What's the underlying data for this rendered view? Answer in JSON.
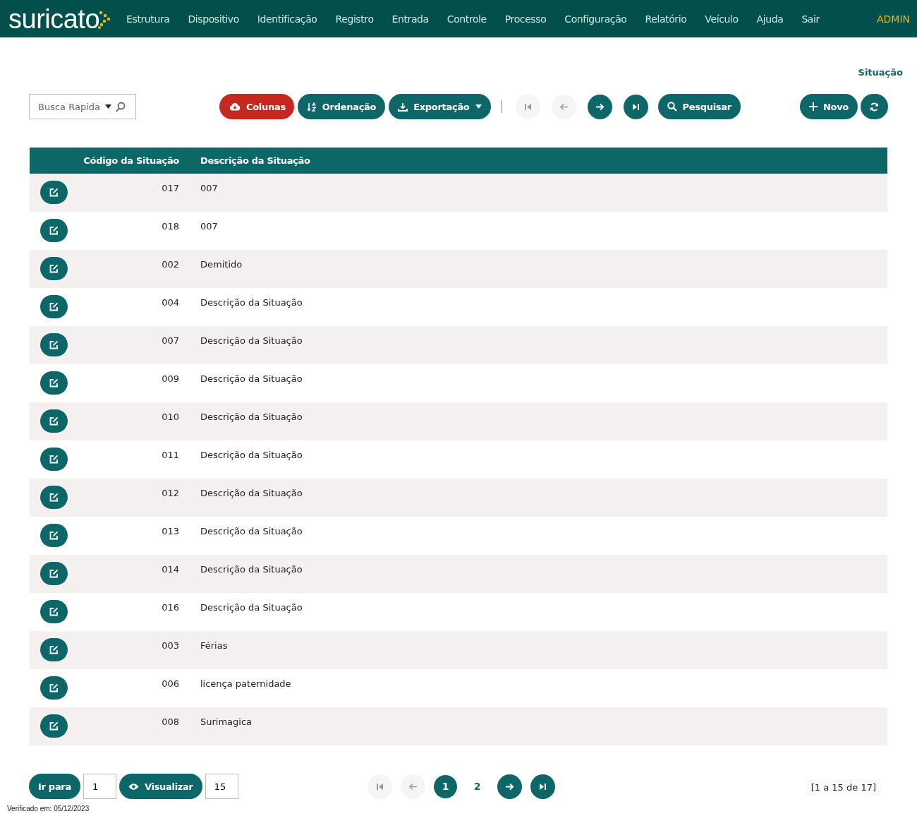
{
  "nav": {
    "logo": "suricato",
    "items": [
      "Estrutura",
      "Dispositivo",
      "Identificação",
      "Registro",
      "Entrada",
      "Controle",
      "Processo",
      "Configuração",
      "Relatório",
      "Veículo",
      "Ajuda",
      "Sair"
    ],
    "user": "ADMIN"
  },
  "page_title": "Situação",
  "toolbar": {
    "search": {
      "placeholder": "Busca Rapida"
    },
    "actions": [
      {
        "kind": "columns",
        "label": "Colunas"
      },
      {
        "kind": "sort",
        "label": "Ordenação"
      },
      {
        "kind": "export",
        "label": "Exportação"
      }
    ],
    "nav_buttons": [
      {
        "kind": "first",
        "disabled": true
      },
      {
        "kind": "prev",
        "disabled": true
      },
      {
        "kind": "next",
        "disabled": false
      },
      {
        "kind": "last",
        "disabled": false
      }
    ],
    "search_button": "Pesquisar",
    "new_button": "Novo"
  },
  "table": {
    "columns": [
      "Código da Situação",
      "Descrição da Situação"
    ],
    "rows": [
      {
        "code": "017",
        "description": "007"
      },
      {
        "code": "018",
        "description": "007"
      },
      {
        "code": "002",
        "description": "Demitido"
      },
      {
        "code": "004",
        "description": "Descrição da Situação"
      },
      {
        "code": "007",
        "description": "Descrição da Situação"
      },
      {
        "code": "009",
        "description": "Descrição da Situação"
      },
      {
        "code": "010",
        "description": "Descrição da Situação"
      },
      {
        "code": "011",
        "description": "Descrição da Situação"
      },
      {
        "code": "012",
        "description": "Descrição da Situação"
      },
      {
        "code": "013",
        "description": "Descrição da Situação"
      },
      {
        "code": "014",
        "description": "Descrição da Situação"
      },
      {
        "code": "016",
        "description": "Descrição da Situação"
      },
      {
        "code": "003",
        "description": "Férias"
      },
      {
        "code": "006",
        "description": "licença paternidade"
      },
      {
        "code": "008",
        "description": "Surimagica"
      }
    ]
  },
  "pager": {
    "goto_label": "Ir para",
    "goto_value": "1",
    "view_label": "Visualizar",
    "view_value": "15",
    "nav_buttons": [
      {
        "kind": "first",
        "disabled": true
      },
      {
        "kind": "prev",
        "disabled": true
      },
      {
        "kind": "next",
        "disabled": false
      },
      {
        "kind": "last",
        "disabled": false
      }
    ],
    "pages": [
      {
        "label": "1",
        "selected": true
      },
      {
        "label": "2",
        "selected": false
      }
    ],
    "summary": "[1 a 15 de 17]"
  },
  "footer": "Verificado em: 05/12/2023"
}
